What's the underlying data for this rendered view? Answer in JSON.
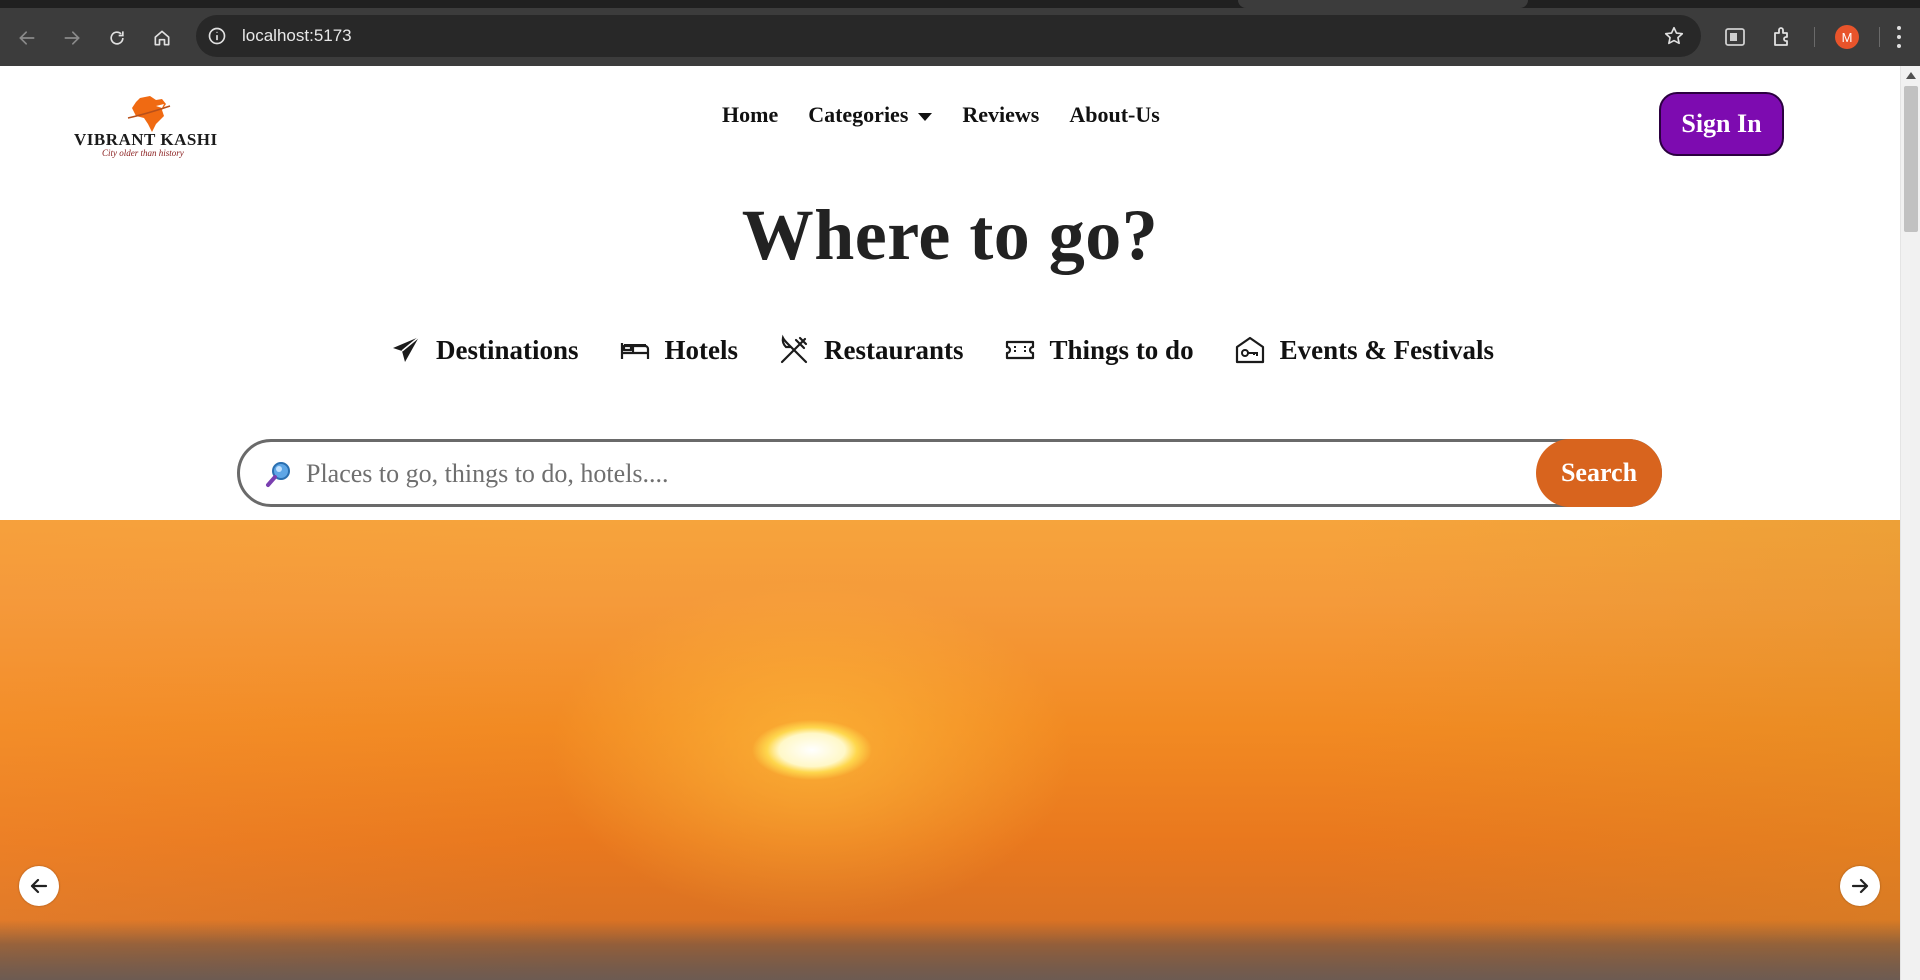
{
  "browser": {
    "url": "localhost:5173",
    "profile_initial": "M"
  },
  "site": {
    "logo_text": "VIBRANT KASHI",
    "logo_tagline": "City older than history",
    "nav": [
      {
        "label": "Home"
      },
      {
        "label": "Categories",
        "has_dropdown": true
      },
      {
        "label": "Reviews"
      },
      {
        "label": "About-Us"
      }
    ],
    "signin_label": "Sign In",
    "signin_color": "#7d0bb0"
  },
  "hero": {
    "title": "Where to go?",
    "categories": [
      {
        "label": "Destinations",
        "icon": "paper-plane-icon"
      },
      {
        "label": "Hotels",
        "icon": "bed-icon"
      },
      {
        "label": "Restaurants",
        "icon": "utensils-icon"
      },
      {
        "label": "Things to do",
        "icon": "ticket-icon"
      },
      {
        "label": "Events & Festivals",
        "icon": "house-key-icon"
      }
    ]
  },
  "search": {
    "placeholder": "Places to go, things to do, hotels....",
    "button_label": "Search",
    "button_color": "#d8641e"
  },
  "carousel": {
    "image": "sunset-over-river",
    "prev_icon": "arrow-left-icon",
    "next_icon": "arrow-right-icon"
  }
}
